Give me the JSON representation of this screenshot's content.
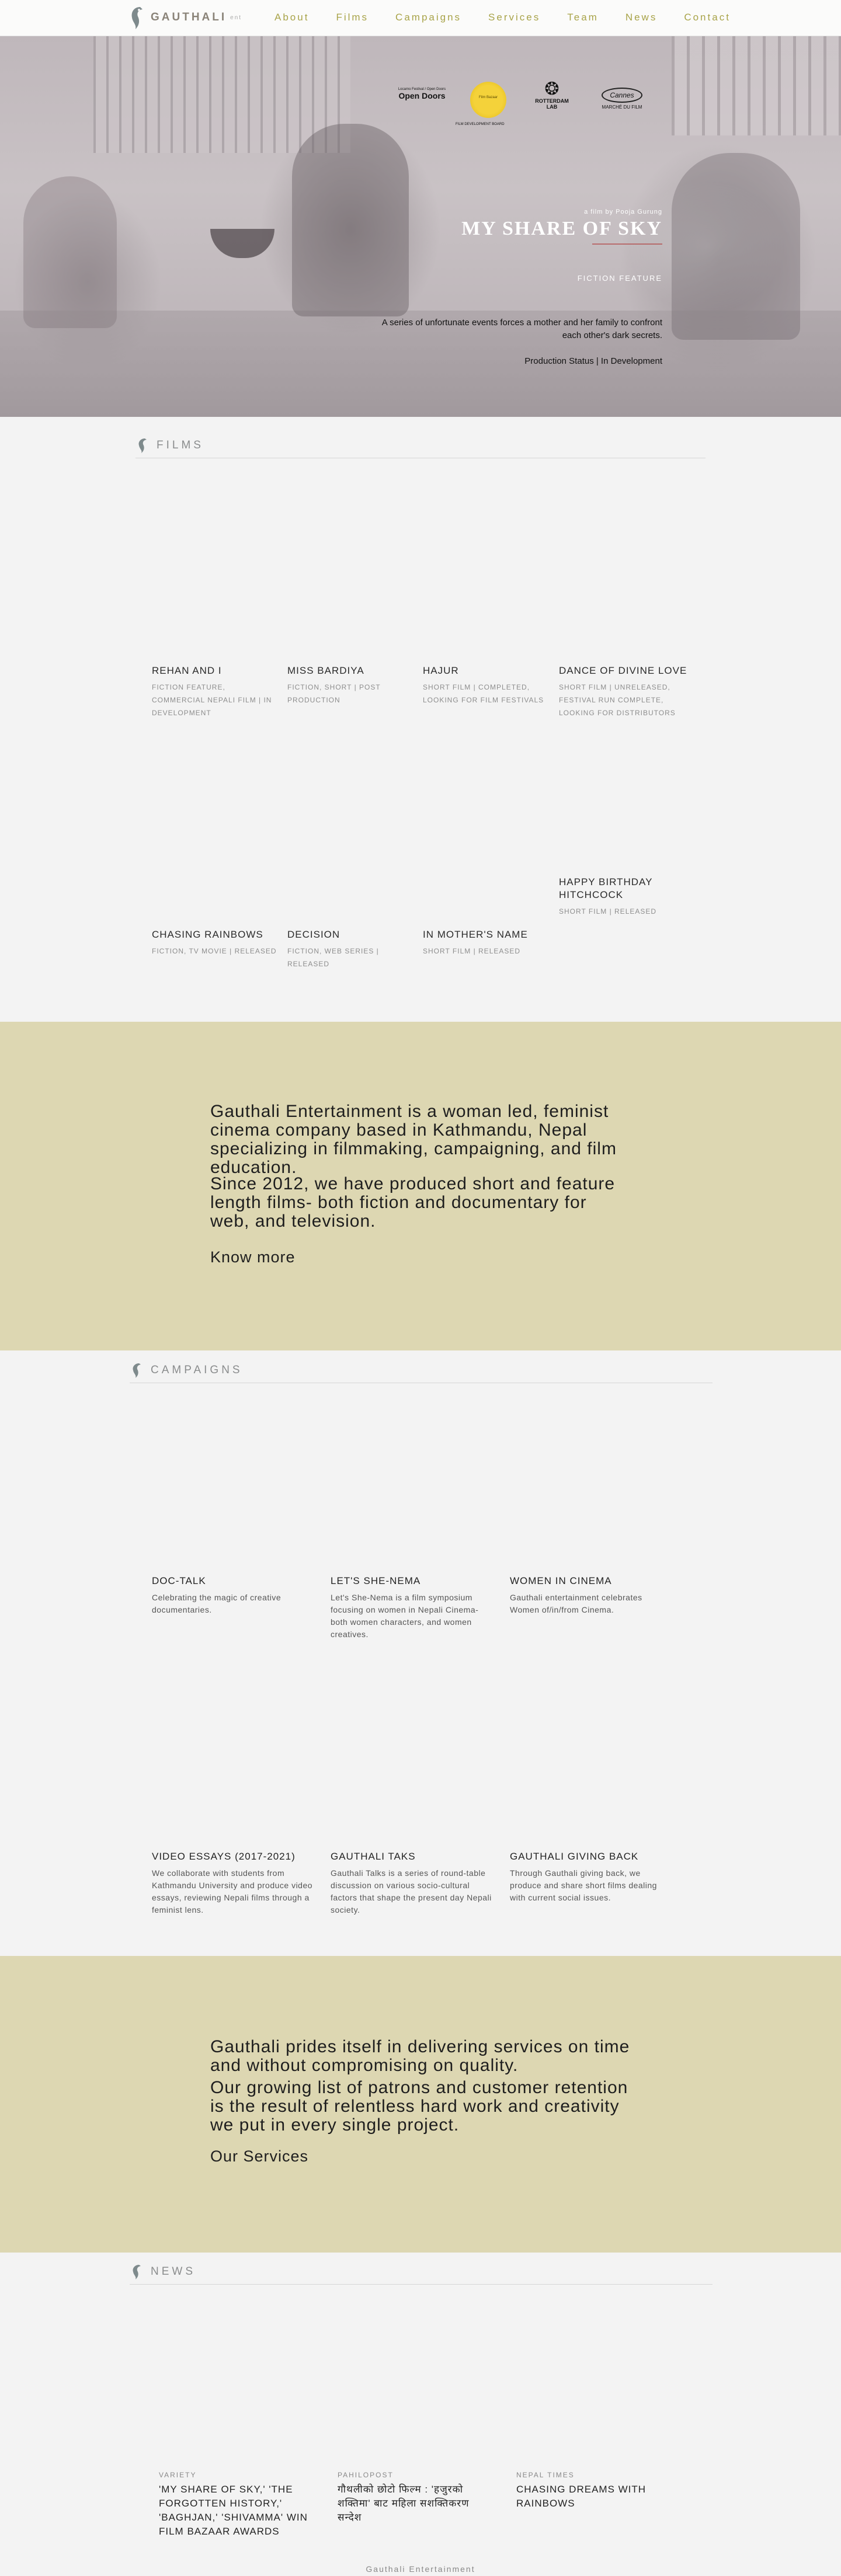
{
  "brand": {
    "name": "GAUTHALI",
    "suffix": "ent"
  },
  "nav": {
    "items": [
      "About",
      "Films",
      "Campaigns",
      "Services",
      "Team",
      "News",
      "Contact"
    ]
  },
  "hero": {
    "laurels": {
      "open_doors_small": "Locarno Festival / Open Doors",
      "open_doors": "Open Doors",
      "sun_text": "Film Bazaar",
      "rotterdam": "ROTTERDAM LAB",
      "marche": "MARCHÉ DU FILM",
      "marche_icon": "Cannes",
      "fdb": "FILM DEVELOPMENT BOARD"
    },
    "kicker": "a film by Pooja Gurung",
    "title": "MY SHARE OF SKY",
    "genre": "FICTION FEATURE",
    "description": "A series of unfortunate events forces a mother and her family to confront each other's dark secrets.",
    "status": "Production Status | In Development"
  },
  "films": {
    "heading": "FILMS",
    "items": [
      {
        "title": "REHAN AND I",
        "meta": "FICTION FEATURE, COMMERCIAL NEPALI FILM | IN DEVELOPMENT"
      },
      {
        "title": "MISS BARDIYA",
        "meta": "FICTION, SHORT | POST PRODUCTION"
      },
      {
        "title": "HAJUR",
        "meta": "SHORT FILM | COMPLETED, LOOKING FOR FILM FESTIVALS"
      },
      {
        "title": "DANCE OF DIVINE LOVE",
        "meta": "SHORT FILM | UNRELEASED, FESTIVAL RUN COMPLETE, LOOKING FOR DISTRIBUTORS"
      },
      {
        "title": "HAPPY BIRTHDAY HITCHCOCK",
        "meta": "SHORT FILM | RELEASED"
      },
      {
        "title": "CHASING RAINBOWS",
        "meta": "FICTION, TV MOVIE | RELEASED"
      },
      {
        "title": "DECISION",
        "meta": "FICTION, WEB SERIES | RELEASED"
      },
      {
        "title": "IN MOTHER'S NAME",
        "meta": "SHORT FILM | RELEASED"
      }
    ]
  },
  "about": {
    "p1": "Gauthali Entertainment is a woman led, feminist cinema company based in Kathmandu, Nepal specializing in filmmaking, campaigning, and film education.",
    "p2": "Since 2012, we have produced short and feature length films- both fiction and documentary for web, and television.",
    "cta": "Know more"
  },
  "campaigns": {
    "heading": "CAMPAIGNS",
    "items": [
      {
        "title": "DOC-TALK",
        "desc": "Celebrating the magic of creative documentaries."
      },
      {
        "title": "LET'S SHE-NEMA",
        "desc": "Let's She-Nema is a film symposium focusing on women in Nepali Cinema- both women characters, and women creatives."
      },
      {
        "title": "WOMEN IN CINEMA",
        "desc": "Gauthali entertainment celebrates Women of/in/from Cinema."
      },
      {
        "title": "VIDEO ESSAYS (2017-2021)",
        "desc": "We collaborate with students from Kathmandu University and produce video essays, reviewing Nepali films through a feminist lens."
      },
      {
        "title": "GAUTHALI TAKS",
        "desc": "Gauthali Talks is a series of round-table discussion on various socio-cultural factors that shape the present day Nepali society."
      },
      {
        "title": "GAUTHALI GIVING BACK",
        "desc": "Through Gauthali giving back, we produce and share short films dealing with current social issues."
      }
    ]
  },
  "services": {
    "p1": "Gauthali prides itself in delivering services on time and without compromising on quality.",
    "p2": "Our growing list of patrons and customer retention is the result of relentless hard work and creativity we put in every single project.",
    "cta": "Our Services"
  },
  "news": {
    "heading": "NEWS",
    "items": [
      {
        "source": "VARIETY",
        "title": "'MY SHARE OF SKY,' 'THE FORGOTTEN HISTORY,' 'BAGHJAN,' 'SHIVAMMA' WIN FILM BAZAAR AWARDS"
      },
      {
        "source": "PAHILOPOST",
        "title": "गौथलीको छोटो फिल्म : 'हजुरको शक्तिमा' बाट महिला सशक्तिकरण सन्देश"
      },
      {
        "source": "NEPAL TIMES",
        "title": "CHASING DREAMS WITH RAINBOWS"
      }
    ]
  },
  "footer": {
    "text": "Gauthali Entertainment"
  }
}
